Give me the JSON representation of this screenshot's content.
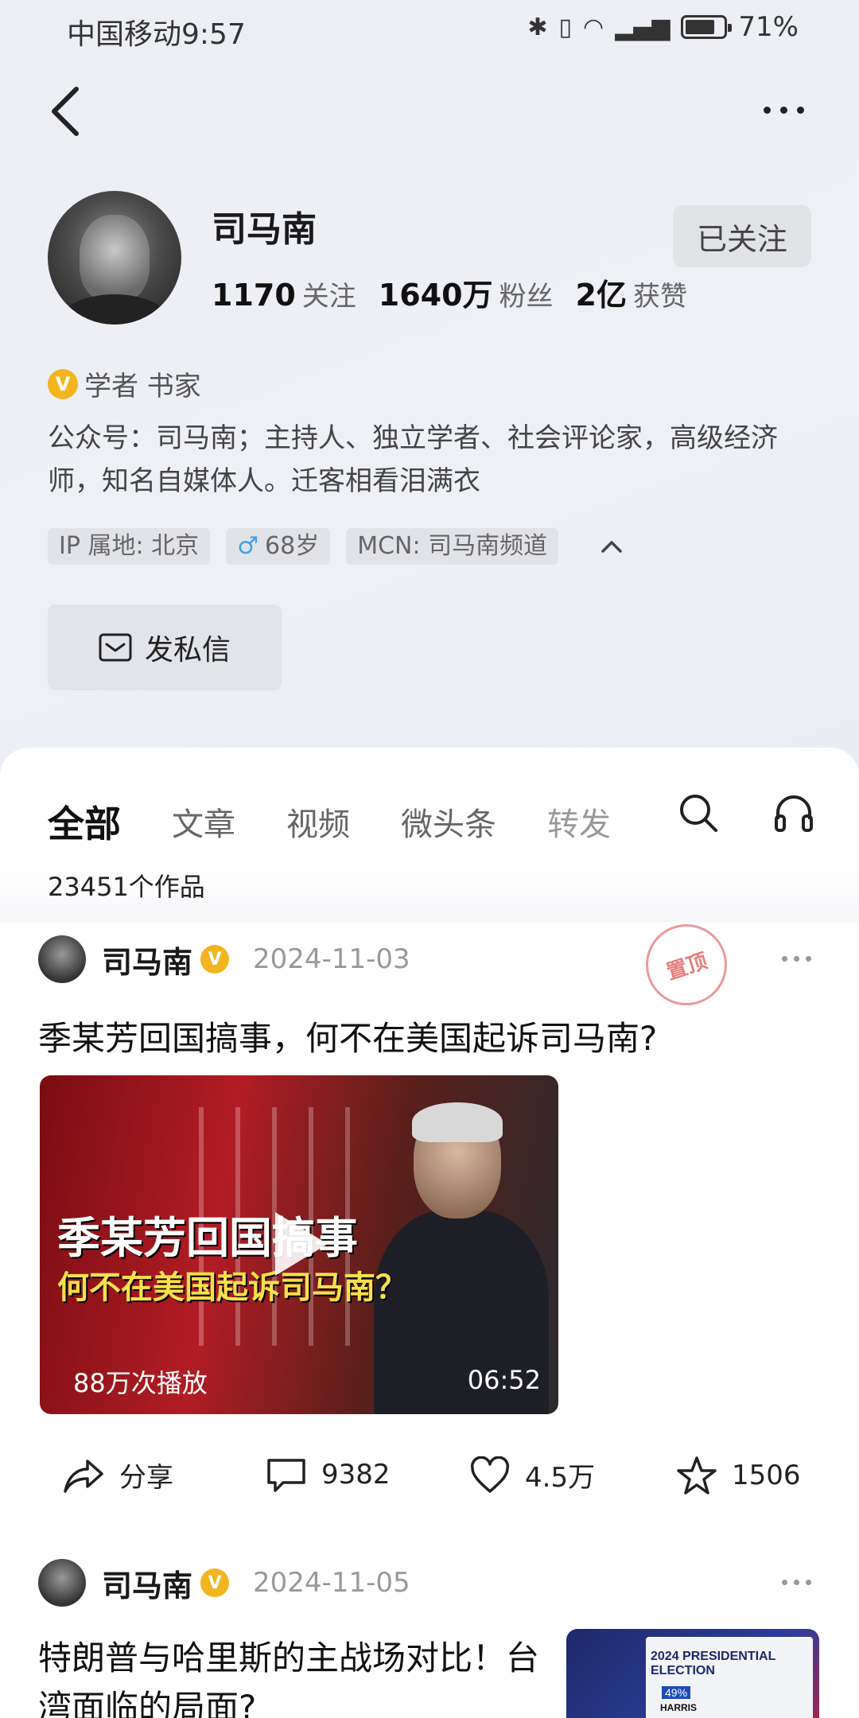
{
  "status_bar": {
    "carrier_time": "中国移动9:57",
    "battery": "71%",
    "icons": [
      "bluetooth-icon",
      "vibrate-icon",
      "wifi-icon",
      "signal-5g-icon",
      "battery-icon"
    ]
  },
  "profile": {
    "name": "司马南",
    "follow_button": "已关注",
    "stats": [
      {
        "value": "1170",
        "label": "关注"
      },
      {
        "value": "1640万",
        "label": "粉丝"
      },
      {
        "value": "2亿",
        "label": "获赞"
      }
    ],
    "verified_badge": "V",
    "verified_title": "学者 书家",
    "bio": "公众号：司马南；主持人、独立学者、社会评论家，高级经济师，知名自媒体人。迁客相看泪满衣",
    "tags": {
      "ip": "IP 属地: 北京",
      "age": "68岁",
      "mcn": "MCN: 司马南频道"
    },
    "dm_button": "发私信"
  },
  "tabs": [
    "全部",
    "文章",
    "视频",
    "微头条",
    "转发"
  ],
  "works_count": "23451个作品",
  "posts": [
    {
      "author": "司马南",
      "badge": "V",
      "date": "2024-11-03",
      "pin_label": "置顶",
      "title": "季某芳回国搞事，何不在美国起诉司马南?",
      "video": {
        "overlay_line1": "季某芳回国搞事",
        "overlay_line2": "何不在美国起诉司马南？",
        "views": "88万次播放",
        "duration": "06:52"
      },
      "actions": {
        "share": "分享",
        "comments": "9382",
        "likes": "4.5万",
        "favorites": "1506"
      }
    },
    {
      "author": "司马南",
      "badge": "V",
      "date": "2024-11-05",
      "title": "特朗普与哈里斯的主战场对比！台湾面临的局面?",
      "thumbnail": {
        "headline": "2024 PRESIDENTIAL ELECTION",
        "percent": "49%",
        "name": "HARRIS"
      }
    }
  ],
  "colors": {
    "badge_gold": "#f2b51f",
    "pin_red": "#e06a6a",
    "male_blue": "#3aa3e8"
  }
}
